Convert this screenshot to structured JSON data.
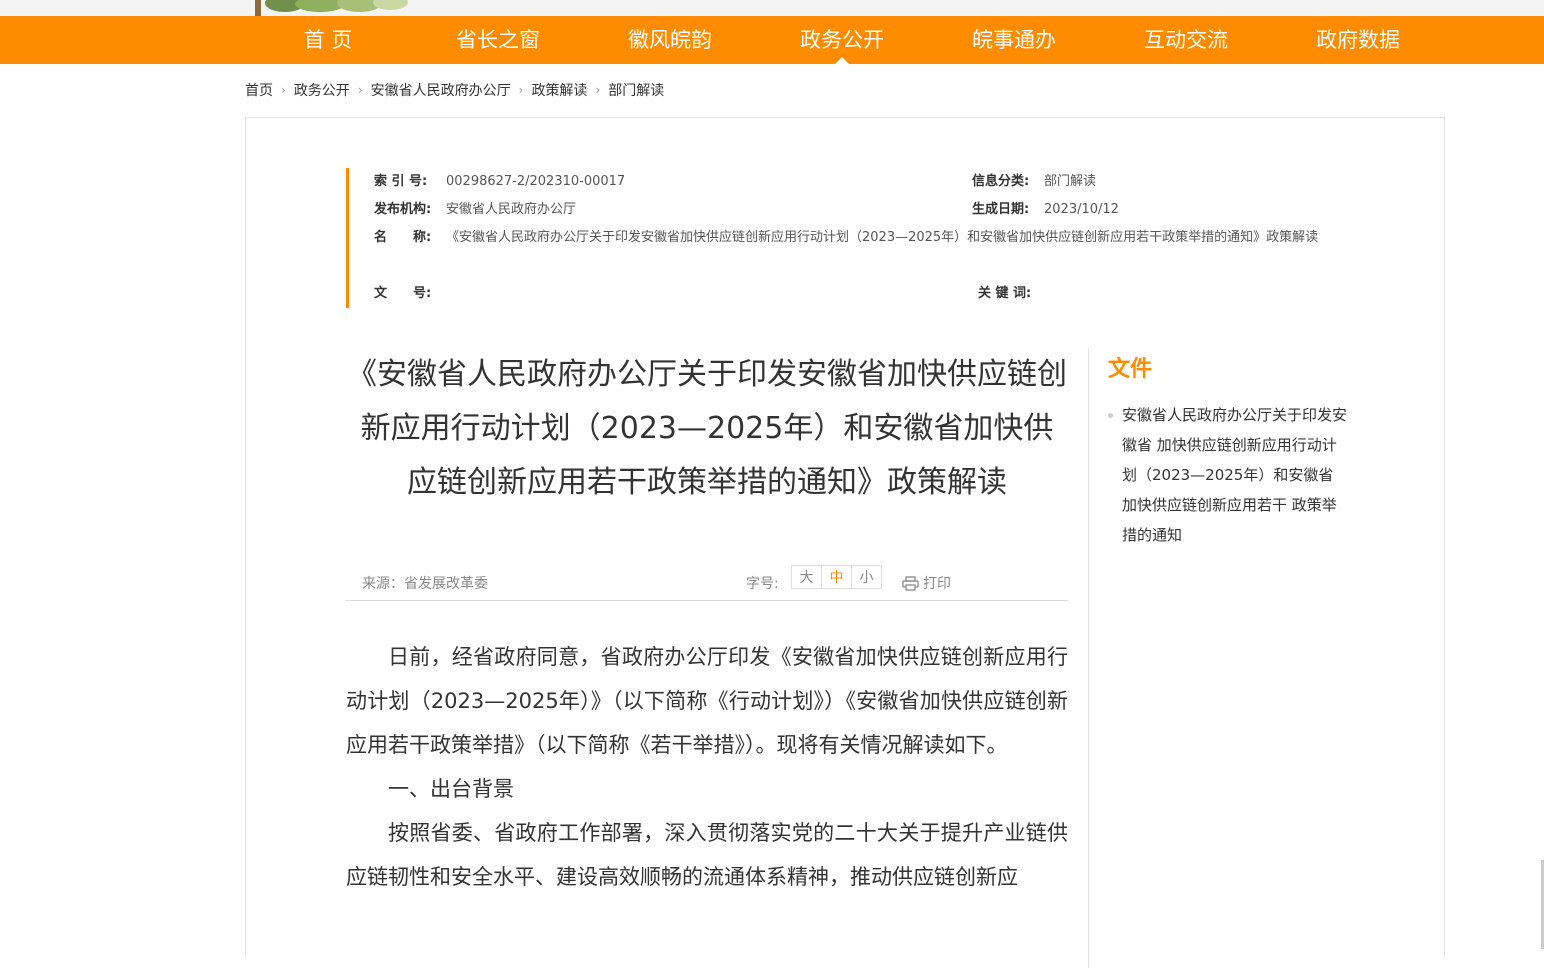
{
  "nav": {
    "items": [
      {
        "label": "首 页"
      },
      {
        "label": "省长之窗"
      },
      {
        "label": "徽风皖韵"
      },
      {
        "label": "政务公开"
      },
      {
        "label": "皖事通办"
      },
      {
        "label": "互动交流"
      },
      {
        "label": "政府数据"
      }
    ],
    "active_index": 3
  },
  "breadcrumb": [
    "首页",
    "政务公开",
    "安徽省人民政府办公厅",
    "政策解读",
    "部门解读"
  ],
  "meta": {
    "index_label": "索 引 号:",
    "index_value": "00298627-2/202310-00017",
    "category_label": "信息分类:",
    "category_value": "部门解读",
    "publisher_label": "发布机构:",
    "publisher_value": "安徽省人民政府办公厅",
    "date_label": "生成日期:",
    "date_value": "2023/10/12",
    "name_label": "名　　称:",
    "name_value": "《安徽省人民政府办公厅关于印发安徽省加快供应链创新应用行动计划（2023—2025年）和安徽省加快供应链创新应用若干政策举措的通知》政策解读",
    "docno_label": "文　　号:",
    "docno_value": "",
    "keywords_label": "关 键 词:",
    "keywords_value": ""
  },
  "article": {
    "title": "《安徽省人民政府办公厅关于印发安徽省加快供应链创新应用行动计划（2023—2025年）和安徽省加快供应链创新应用若干政策举措的通知》政策解读",
    "source": "来源：省发展改革委",
    "font_label": "字号:",
    "font_large": "大",
    "font_medium": "中",
    "font_small": "小",
    "print_label": "打印",
    "paragraphs": [
      "日前，经省政府同意，省政府办公厅印发《安徽省加快供应链创新应用行动计划（2023—2025年）》（以下简称《行动计划》）《安徽省加快供应链创新应用若干政策举措》（以下简称《若干举措》）。现将有关情况解读如下。",
      "一、出台背景",
      "按照省委、省政府工作部署，深入贯彻落实党的二十大关于提升产业链供应链韧性和安全水平、建设高效顺畅的流通体系精神，推动供应链创新应"
    ]
  },
  "sidebar": {
    "title": "文件",
    "items": [
      "安徽省人民政府办公厅关于印发安徽省 加快供应链创新应用行动计划（2023—2025年）和安徽省加快供应链创新应用若干 政策举措的通知"
    ]
  },
  "colors": {
    "accent": "#ff8c00"
  }
}
